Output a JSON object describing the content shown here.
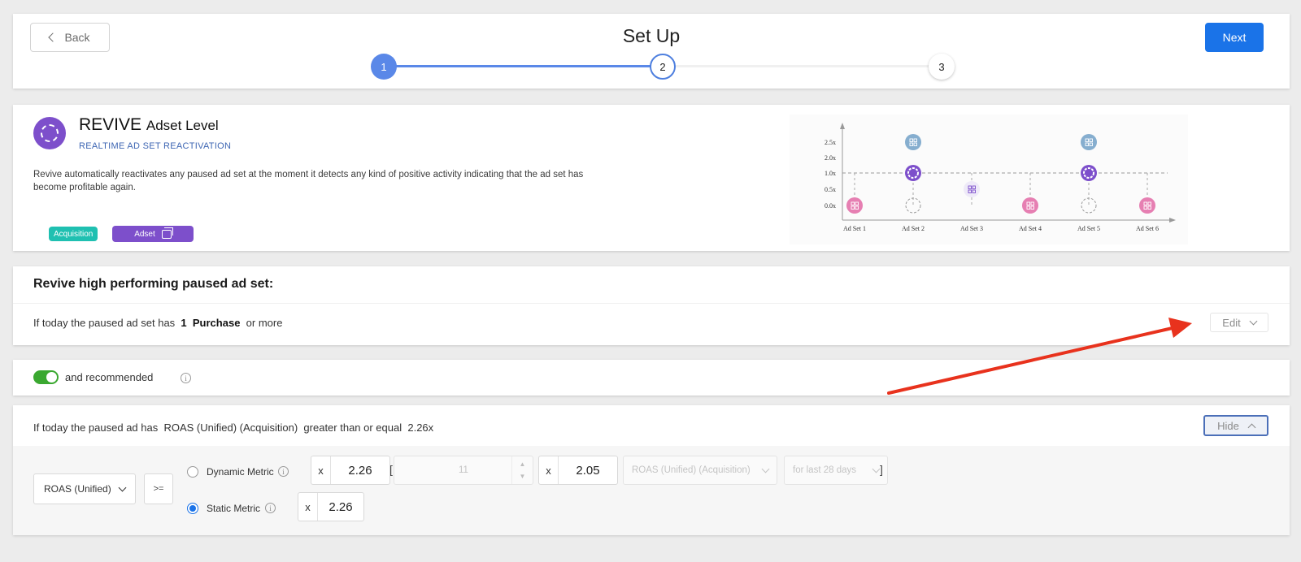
{
  "header": {
    "back_label": "Back",
    "title": "Set Up",
    "next_label": "Next",
    "steps": [
      "1",
      "2",
      "3"
    ]
  },
  "info": {
    "title": "REVIVE",
    "title_level": "Adset Level",
    "subtitle": "REALTIME AD SET REACTIVATION",
    "description": "Revive automatically reactivates any paused ad set at the moment it detects any kind of positive activity indicating that the ad set has become profitable again.",
    "tags": {
      "acquisition": "Acquisition",
      "adset": "Adset"
    },
    "colors": {
      "purple": "#7d4fcb",
      "teal": "#1fc0b1"
    }
  },
  "chart_data": {
    "type": "scatter",
    "categories": [
      "Ad Set 1",
      "Ad Set 2",
      "Ad Set 3",
      "Ad Set 4",
      "Ad Set 5",
      "Ad Set 6"
    ],
    "y_ticks": [
      "0.0x",
      "0.5x",
      "1.0x",
      "2.0x",
      "2.5x"
    ],
    "threshold_label": "1.0x",
    "points": [
      {
        "category": "Ad Set 1",
        "y": "0.0x",
        "kind": "pink"
      },
      {
        "category": "Ad Set 2",
        "y": "2.5x",
        "kind": "teal"
      },
      {
        "category": "Ad Set 2",
        "y": "1.0x",
        "kind": "revive"
      },
      {
        "category": "Ad Set 2",
        "y": "0.0x",
        "kind": "ghost"
      },
      {
        "category": "Ad Set 3",
        "y": "0.5x",
        "kind": "purple"
      },
      {
        "category": "Ad Set 4",
        "y": "0.0x",
        "kind": "pink"
      },
      {
        "category": "Ad Set 5",
        "y": "2.5x",
        "kind": "teal"
      },
      {
        "category": "Ad Set 5",
        "y": "1.0x",
        "kind": "revive"
      },
      {
        "category": "Ad Set 5",
        "y": "0.0x",
        "kind": "ghost"
      },
      {
        "category": "Ad Set 6",
        "y": "0.0x",
        "kind": "pink"
      }
    ],
    "grid": false
  },
  "rule": {
    "heading": "Revive high performing paused ad set:",
    "prefix": "If today the paused ad set has",
    "count": "1",
    "event": "Purchase",
    "suffix": "or more",
    "edit_label": "Edit"
  },
  "recommended": {
    "enabled": true,
    "label": "and recommended",
    "colors": {
      "on": "#3aa830"
    }
  },
  "condition": {
    "prefix": "If today the paused ad has",
    "metric": "ROAS (Unified) (Acquisition)",
    "operator_text": "greater than or equal",
    "value": "2.26x",
    "hide_label": "Hide",
    "metric_select": "ROAS (Unified)",
    "operator": ">=",
    "dynamic": {
      "label": "Dynamic Metric",
      "selected": false,
      "multiplier_x": "x",
      "multiplier": "2.26",
      "bracket_open": "[",
      "days": "11",
      "second_x": "x",
      "second_multiplier": "2.05",
      "metric_dropdown": "ROAS (Unified) (Acquisition)",
      "period_dropdown": "for last 28 days",
      "bracket_close": "]"
    },
    "static": {
      "label": "Static Metric",
      "selected": true,
      "multiplier_x": "x",
      "multiplier": "2.26"
    },
    "colors": {
      "primary": "#1a73e8",
      "hide_border": "#4b6fb8"
    }
  },
  "annotation": {
    "arrow_color": "#e8321d"
  }
}
